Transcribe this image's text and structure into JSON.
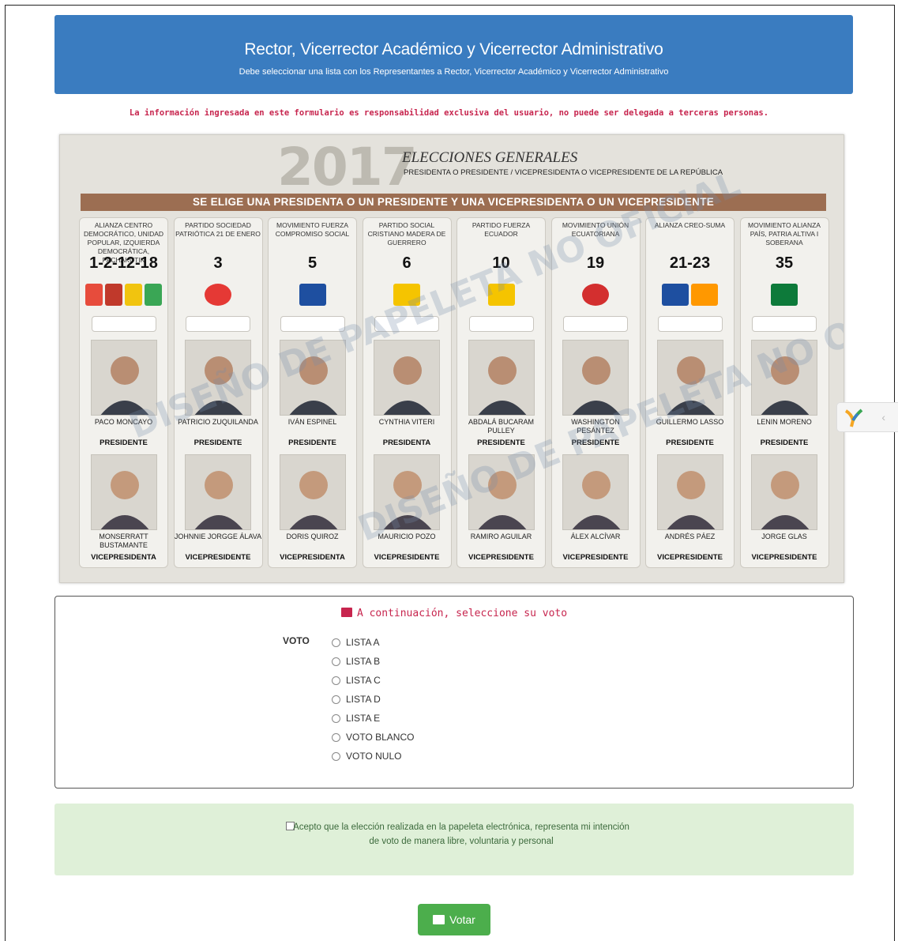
{
  "header": {
    "title": "Rector, Vicerrector Académico y Vicerrector Administrativo",
    "subtitle": "Debe seleccionar una lista con los Representantes a Rector, Vicerrector Académico y Vicerrector Administrativo"
  },
  "warning": "La información ingresada en este formulario es responsabilidad exclusiva del usuario, no puede ser delegada a terceras personas.",
  "ballot": {
    "year": "2017",
    "title": "ELECCIONES GENERALES",
    "subtitle": "PRESIDENTA O PRESIDENTE / VICEPRESIDENTA O VICEPRESIDENTE DE LA REPÚBLICA",
    "band": "SE ELIGE UNA PRESIDENTA O UN PRESIDENTE Y UNA VICEPRESIDENTA O UN VICEPRESIDENTE",
    "watermark": "DISEÑO DE PAPELETA NO OFICIAL",
    "columns": [
      {
        "party": "ALIANZA CENTRO DEMOCRÁTICO, UNIDAD POPULAR, IZQUIERDA DEMOCRÁTICA, PACHAKUTIK",
        "number": "1-2-12-18",
        "president": "PACO MONCAYO",
        "president_role": "PRESIDENTE",
        "vice": "MONSERRATT BUSTAMANTE",
        "vice_role": "VICEPRESIDENTA"
      },
      {
        "party": "PARTIDO SOCIEDAD PATRIÓTICA 21 DE ENERO",
        "number": "3",
        "president": "PATRICIO ZUQUILANDA",
        "president_role": "PRESIDENTE",
        "vice": "JOHNNIE JORGGE ÁLAVA",
        "vice_role": "VICEPRESIDENTE"
      },
      {
        "party": "MOVIMIENTO FUERZA COMPROMISO SOCIAL",
        "number": "5",
        "president": "IVÁN ESPINEL",
        "president_role": "PRESIDENTE",
        "vice": "DORIS QUIROZ",
        "vice_role": "VICEPRESIDENTA"
      },
      {
        "party": "PARTIDO SOCIAL CRISTIANO MADERA DE GUERRERO",
        "number": "6",
        "president": "CYNTHIA VITERI",
        "president_role": "PRESIDENTA",
        "vice": "MAURICIO POZO",
        "vice_role": "VICEPRESIDENTE"
      },
      {
        "party": "PARTIDO FUERZA ECUADOR",
        "number": "10",
        "president": "ABDALÁ BUCARAM PULLEY",
        "president_role": "PRESIDENTE",
        "vice": "RAMIRO AGUILAR",
        "vice_role": "VICEPRESIDENTE"
      },
      {
        "party": "MOVIMIENTO UNIÓN ECUATORIANA",
        "number": "19",
        "president": "WASHINGTON PESÁNTEZ",
        "president_role": "PRESIDENTE",
        "vice": "ÁLEX ALCÍVAR",
        "vice_role": "VICEPRESIDENTE"
      },
      {
        "party": "ALIANZA CREO-SUMA",
        "number": "21-23",
        "president": "GUILLERMO LASSO",
        "president_role": "PRESIDENTE",
        "vice": "ANDRÉS PÁEZ",
        "vice_role": "VICEPRESIDENTE"
      },
      {
        "party": "MOVIMIENTO ALIANZA PAÍS, PATRIA ALTIVA I SOBERANA",
        "number": "35",
        "president": "LENIN MORENO",
        "president_role": "PRESIDENTE",
        "vice": "JORGE GLAS",
        "vice_role": "VICEPRESIDENTE"
      }
    ]
  },
  "vote": {
    "heading": "A continuación, seleccione su voto",
    "label": "VOTO",
    "options": [
      "LISTA A",
      "LISTA B",
      "LISTA C",
      "LISTA D",
      "LISTA E",
      "VOTO BLANCO",
      "VOTO NULO"
    ]
  },
  "accept": {
    "text": "Acepto que la elección realizada en la papeleta electrónica, representa mi intención de voto de manera libre, voluntaria y personal"
  },
  "submit_label": "Votar",
  "colors": {
    "header_bg": "#3a7cc0",
    "warning_text": "#c7254e",
    "band_bg": "#9c6e52",
    "accept_bg": "#dff0d8",
    "button_bg": "#4cae4c"
  }
}
